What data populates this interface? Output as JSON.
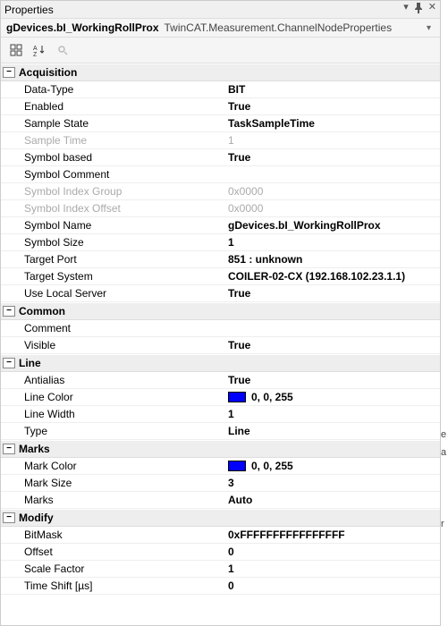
{
  "window": {
    "title": "Properties"
  },
  "object": {
    "name": "gDevices.bI_WorkingRollProx",
    "type": "TwinCAT.Measurement.ChannelNodeProperties"
  },
  "categories": [
    {
      "name": "Acquisition",
      "props": [
        {
          "label": "Data-Type",
          "value": "BIT",
          "bold": true
        },
        {
          "label": "Enabled",
          "value": "True",
          "bold": true
        },
        {
          "label": "Sample State",
          "value": "TaskSampleTime",
          "bold": true
        },
        {
          "label": "Sample Time",
          "value": "1",
          "disabled": true
        },
        {
          "label": "Symbol based",
          "value": "True",
          "bold": true
        },
        {
          "label": "Symbol Comment",
          "value": ""
        },
        {
          "label": "Symbol Index Group",
          "value": "0x0000",
          "disabled": true
        },
        {
          "label": "Symbol Index Offset",
          "value": "0x0000",
          "disabled": true
        },
        {
          "label": "Symbol Name",
          "value": "gDevices.bI_WorkingRollProx",
          "bold": true
        },
        {
          "label": "Symbol Size",
          "value": "1",
          "bold": true
        },
        {
          "label": "Target Port",
          "value": "851 : unknown",
          "bold": true
        },
        {
          "label": "Target System",
          "value": "COILER-02-CX (192.168.102.23.1.1)",
          "bold": true
        },
        {
          "label": "Use Local Server",
          "value": "True",
          "bold": true
        }
      ]
    },
    {
      "name": "Common",
      "props": [
        {
          "label": "Comment",
          "value": ""
        },
        {
          "label": "Visible",
          "value": "True",
          "bold": true
        }
      ]
    },
    {
      "name": "Line",
      "props": [
        {
          "label": "Antialias",
          "value": "True",
          "bold": true
        },
        {
          "label": "Line Color",
          "value": "0, 0, 255",
          "bold": true,
          "swatch": "#0000ff"
        },
        {
          "label": "Line Width",
          "value": "1",
          "bold": true
        },
        {
          "label": "Type",
          "value": "Line",
          "bold": true
        }
      ]
    },
    {
      "name": "Marks",
      "props": [
        {
          "label": "Mark Color",
          "value": "0, 0, 255",
          "bold": true,
          "swatch": "#0000ff"
        },
        {
          "label": "Mark Size",
          "value": "3",
          "bold": true
        },
        {
          "label": "Marks",
          "value": "Auto",
          "bold": true
        }
      ]
    },
    {
      "name": "Modify",
      "props": [
        {
          "label": "BitMask",
          "value": "0xFFFFFFFFFFFFFFFF",
          "bold": true
        },
        {
          "label": "Offset",
          "value": "0",
          "bold": true
        },
        {
          "label": "Scale Factor",
          "value": "1",
          "bold": true
        },
        {
          "label": "Time Shift [µs]",
          "value": "0",
          "bold": true
        }
      ]
    }
  ]
}
